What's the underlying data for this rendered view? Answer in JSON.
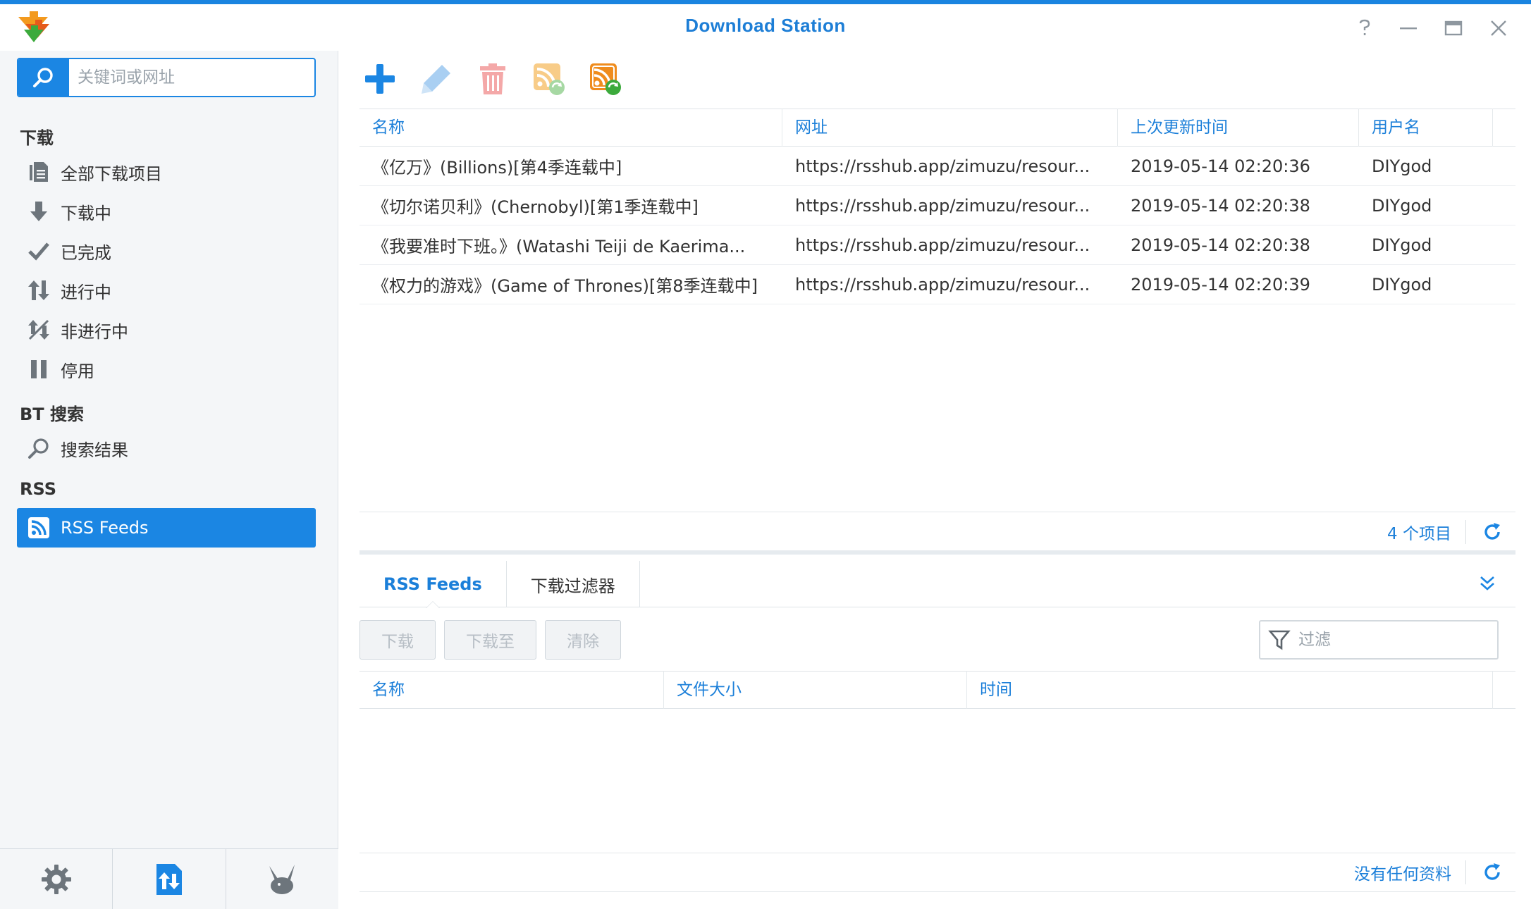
{
  "window": {
    "title": "Download Station",
    "controls": [
      "help-icon",
      "minimize-icon",
      "maximize-icon",
      "close-icon"
    ]
  },
  "colors": {
    "accent": "#1b86e3",
    "text": "#333333",
    "link": "#1b7fd9"
  },
  "search": {
    "placeholder": "关键词或网址",
    "value": ""
  },
  "sidebar": {
    "sections": [
      {
        "heading": "下载",
        "items": [
          {
            "label": "全部下载项目",
            "icon": "all-downloads-icon"
          },
          {
            "label": "下载中",
            "icon": "arrow-down-icon"
          },
          {
            "label": "已完成",
            "icon": "checkmark-icon"
          },
          {
            "label": "进行中",
            "icon": "up-down-arrows-icon"
          },
          {
            "label": "非进行中",
            "icon": "inactive-icon"
          },
          {
            "label": "停用",
            "icon": "pause-icon"
          }
        ]
      },
      {
        "heading": "BT 搜索",
        "items": [
          {
            "label": "搜索结果",
            "icon": "search-icon"
          }
        ]
      },
      {
        "heading": "RSS",
        "items": [
          {
            "label": "RSS Feeds",
            "icon": "rss-icon",
            "active": true
          }
        ]
      }
    ],
    "bottom_buttons": [
      "settings-icon",
      "transfer-icon",
      "emule-icon"
    ]
  },
  "toolbar": {
    "buttons": [
      "add-icon",
      "edit-icon",
      "delete-icon",
      "rss-update-icon",
      "rss-update-all-icon"
    ]
  },
  "feeds_table": {
    "columns": [
      "名称",
      "网址",
      "上次更新时间",
      "用户名"
    ],
    "rows": [
      [
        "《亿万》(Billions)[第4季连载中]",
        "https://rsshub.app/zimuzu/resour...",
        "2019-05-14 02:20:36",
        "DIYgod"
      ],
      [
        "《切尔诺贝利》(Chernobyl)[第1季连载中]",
        "https://rsshub.app/zimuzu/resour...",
        "2019-05-14 02:20:38",
        "DIYgod"
      ],
      [
        "《我要准时下班。》(Watashi Teiji de Kaerima...",
        "https://rsshub.app/zimuzu/resour...",
        "2019-05-14 02:20:38",
        "DIYgod"
      ],
      [
        "《权力的游戏》(Game of Thrones)[第8季连载中]",
        "https://rsshub.app/zimuzu/resour...",
        "2019-05-14 02:20:39",
        "DIYgod"
      ]
    ],
    "count_text": "4 个项目"
  },
  "detail": {
    "tabs": [
      "RSS Feeds",
      "下载过滤器"
    ],
    "active_tab": 0,
    "actions": [
      "下载",
      "下载至",
      "清除"
    ],
    "filter_placeholder": "过滤",
    "columns": [
      "名称",
      "文件大小",
      "时间"
    ],
    "status_text": "没有任何资料"
  }
}
